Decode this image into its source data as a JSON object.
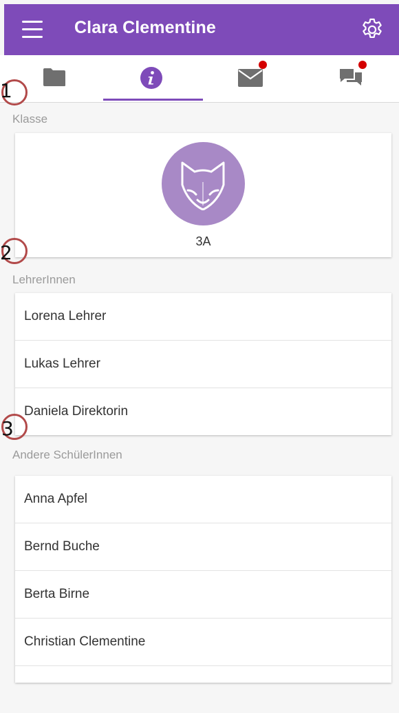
{
  "header": {
    "title": "Clara Clementine",
    "icons": [
      "hamburger-menu-icon",
      "gear-icon"
    ],
    "color": "#7e4bb9"
  },
  "tabs": [
    {
      "icon": "folder-icon",
      "active": false,
      "badge": false
    },
    {
      "icon": "info-icon",
      "active": true,
      "badge": false
    },
    {
      "icon": "mail-icon",
      "active": false,
      "badge": true
    },
    {
      "icon": "chat-icon",
      "active": false,
      "badge": true
    }
  ],
  "sections": {
    "class_label": "Klasse",
    "class_name": "3A",
    "class_avatar_icon": "fox-icon",
    "teachers_label": "LehrerInnen",
    "teachers": [
      "Lorena Lehrer",
      "Lukas Lehrer",
      "Daniela Direktorin"
    ],
    "students_label": "Andere SchülerInnen",
    "students": [
      "Anna Apfel",
      "Bernd Buche",
      "Berta Birne",
      "Christian Clementine"
    ]
  },
  "annotations": [
    "1",
    "2",
    "3"
  ],
  "colors": {
    "accent": "#7e4bb9",
    "badge": "#d40000",
    "avatar_bg": "#a889c6",
    "annotation_circle": "#b24a4a"
  }
}
